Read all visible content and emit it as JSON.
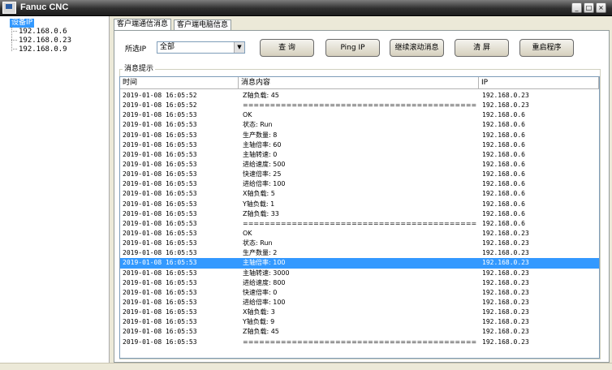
{
  "window": {
    "title": "Fanuc CNC",
    "buttons": [
      "_",
      "□",
      "×"
    ]
  },
  "tree": {
    "root": "设备IP",
    "items": [
      "192.168.0.6",
      "192.168.0.23",
      "192.168.0.9"
    ]
  },
  "tabs": [
    {
      "label": "客户端通信消息",
      "active": true
    },
    {
      "label": "客户端电脑信息",
      "active": false
    }
  ],
  "controls": {
    "ip_label": "所选IP",
    "ip_selected": "全部",
    "query_button": "查  询",
    "ping_button": "Ping IP",
    "scroll_button": "继续滚动消息",
    "clear_button": "清  屏",
    "restart_button": "重启程序"
  },
  "messages": {
    "group_title": "消息提示",
    "columns": [
      "时间",
      "消息内容",
      "IP"
    ],
    "rows": [
      [
        "2019-01-08 16:05:52",
        "Z轴负载: 45",
        "192.168.0.23"
      ],
      [
        "2019-01-08 16:05:52",
        "====================================================",
        "192.168.0.23"
      ],
      [
        "2019-01-08 16:05:53",
        "OK",
        "192.168.0.6"
      ],
      [
        "2019-01-08 16:05:53",
        "状态: Run",
        "192.168.0.6"
      ],
      [
        "2019-01-08 16:05:53",
        "生产数量: 8",
        "192.168.0.6"
      ],
      [
        "2019-01-08 16:05:53",
        "主轴倍率: 60",
        "192.168.0.6"
      ],
      [
        "2019-01-08 16:05:53",
        "主轴转速: 0",
        "192.168.0.6"
      ],
      [
        "2019-01-08 16:05:53",
        "进给速度: 500",
        "192.168.0.6"
      ],
      [
        "2019-01-08 16:05:53",
        "快速倍率: 25",
        "192.168.0.6"
      ],
      [
        "2019-01-08 16:05:53",
        "进给倍率: 100",
        "192.168.0.6"
      ],
      [
        "2019-01-08 16:05:53",
        "X轴负载: 5",
        "192.168.0.6"
      ],
      [
        "2019-01-08 16:05:53",
        "Y轴负载: 1",
        "192.168.0.6"
      ],
      [
        "2019-01-08 16:05:53",
        "Z轴负载: 33",
        "192.168.0.6"
      ],
      [
        "2019-01-08 16:05:53",
        "====================================================",
        "192.168.0.6"
      ],
      [
        "2019-01-08 16:05:53",
        "OK",
        "192.168.0.23"
      ],
      [
        "2019-01-08 16:05:53",
        "状态: Run",
        "192.168.0.23"
      ],
      [
        "2019-01-08 16:05:53",
        "生产数量: 2",
        "192.168.0.23"
      ],
      [
        "2019-01-08 16:05:53",
        "主轴倍率: 100",
        "192.168.0.23"
      ],
      [
        "2019-01-08 16:05:53",
        "主轴转速: 3000",
        "192.168.0.23"
      ],
      [
        "2019-01-08 16:05:53",
        "进给速度: 800",
        "192.168.0.23"
      ],
      [
        "2019-01-08 16:05:53",
        "快速倍率: 0",
        "192.168.0.23"
      ],
      [
        "2019-01-08 16:05:53",
        "进给倍率: 100",
        "192.168.0.23"
      ],
      [
        "2019-01-08 16:05:53",
        "X轴负载: 3",
        "192.168.0.23"
      ],
      [
        "2019-01-08 16:05:53",
        "Y轴负载: 9",
        "192.168.0.23"
      ],
      [
        "2019-01-08 16:05:53",
        "Z轴负载: 45",
        "192.168.0.23"
      ],
      [
        "2019-01-08 16:05:53",
        "====================================================",
        "192.168.0.23"
      ]
    ],
    "selected_row": 17
  },
  "colors": {
    "selection": "#3399ff",
    "titlebar": "#2f2f2f",
    "window_bg": "#ece9d8"
  }
}
